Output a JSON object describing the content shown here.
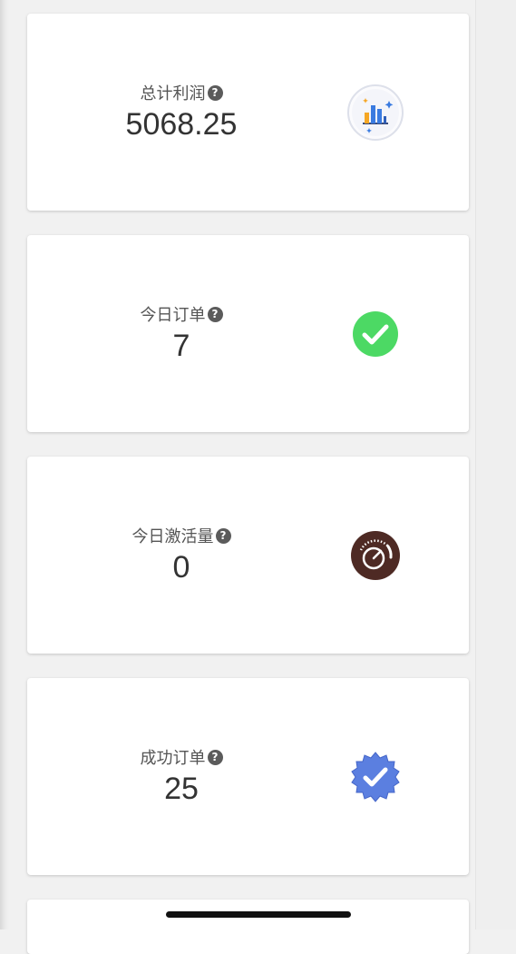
{
  "cards": [
    {
      "label": "总计利润",
      "value": "5068.25",
      "icon": "bar-chart-icon"
    },
    {
      "label": "今日订单",
      "value": "7",
      "icon": "check-circle-icon"
    },
    {
      "label": "今日激活量",
      "value": "0",
      "icon": "speedometer-icon"
    },
    {
      "label": "成功订单",
      "value": "25",
      "icon": "verified-badge-icon"
    }
  ],
  "help_glyph": "?",
  "colors": {
    "check_green": "#4cd964",
    "gauge_brown": "#4e2a24",
    "badge_blue": "#5b7fe0",
    "chart_orange": "#f5a623",
    "chart_blue": "#3a7be0"
  }
}
